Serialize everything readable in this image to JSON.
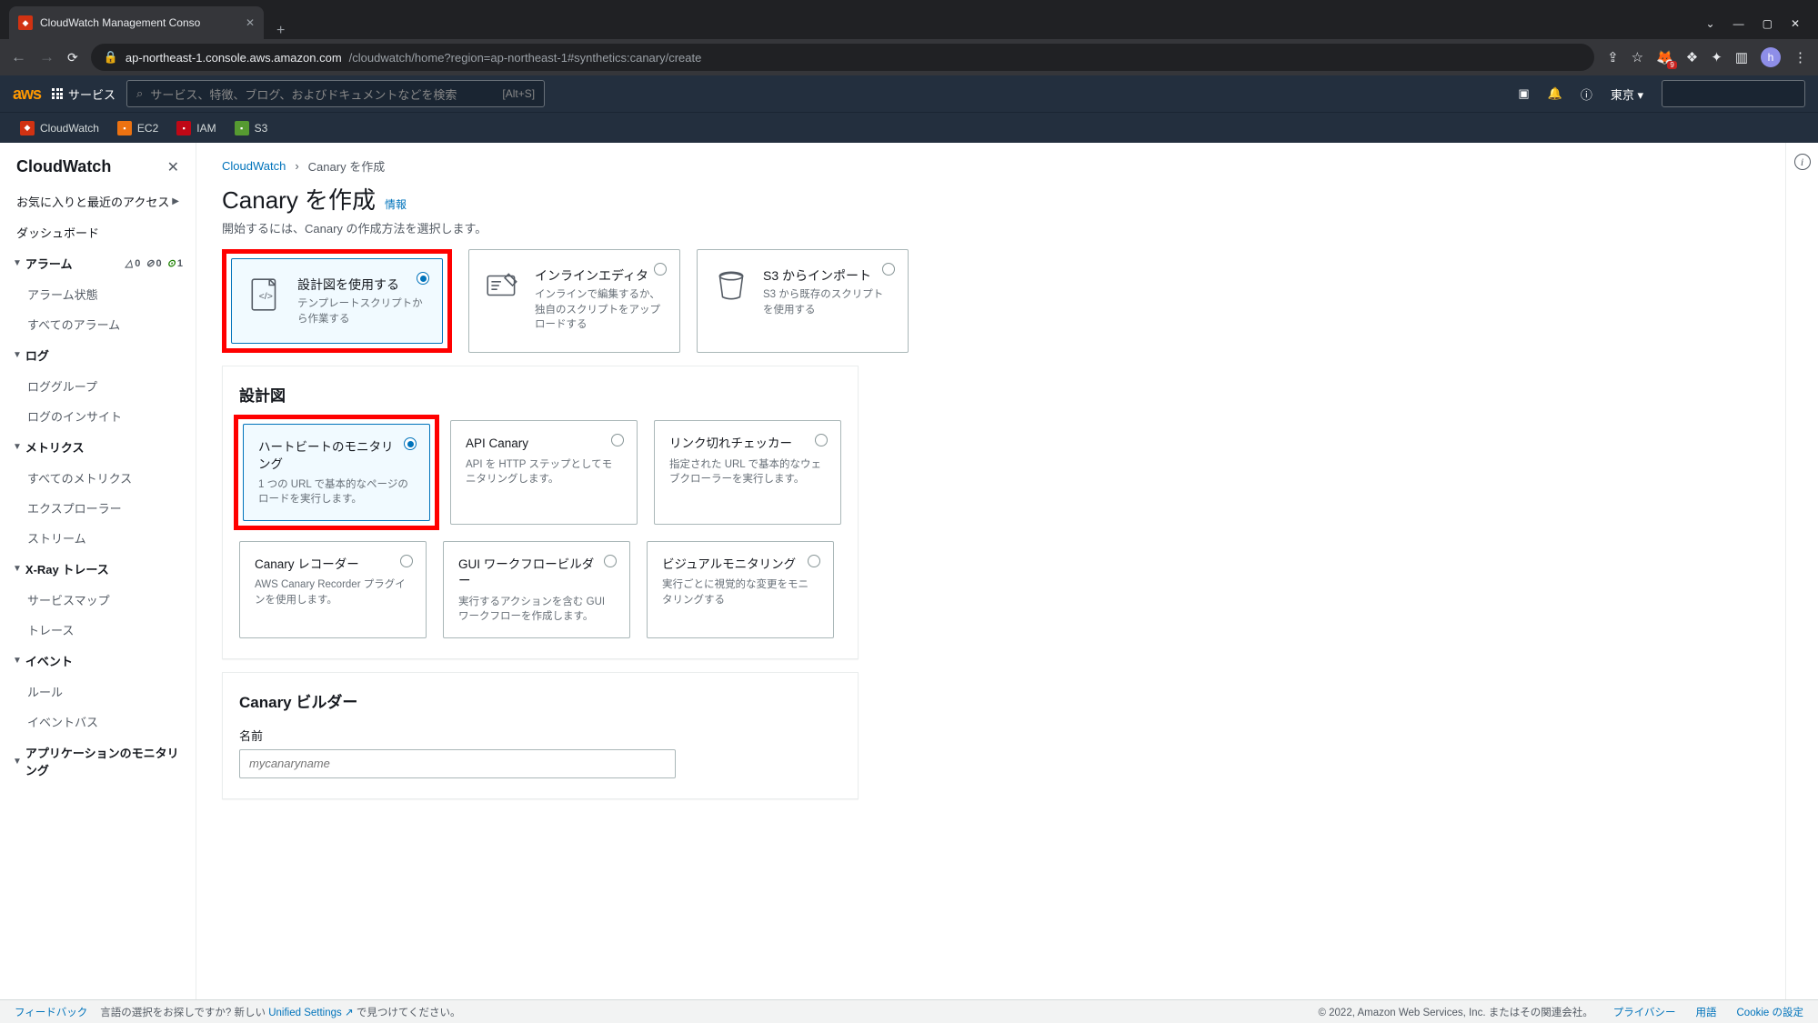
{
  "browser": {
    "tab_title": "CloudWatch Management Conso",
    "url_host": "ap-northeast-1.console.aws.amazon.com",
    "url_path": "/cloudwatch/home?region=ap-northeast-1#synthetics:canary/create"
  },
  "aws_nav": {
    "services_label": "サービス",
    "search_placeholder": "サービス、特徴、ブログ、およびドキュメントなどを検索",
    "search_hint": "[Alt+S]",
    "region": "東京",
    "favorites": [
      {
        "name": "CloudWatch"
      },
      {
        "name": "EC2"
      },
      {
        "name": "IAM"
      },
      {
        "name": "S3"
      }
    ]
  },
  "sidebar": {
    "title": "CloudWatch",
    "recent": "お気に入りと最近のアクセス",
    "dashboard": "ダッシュボード",
    "sections": {
      "alarms": {
        "label": "アラーム",
        "badges": {
          "in_alarm": "0",
          "no_data": "0",
          "ok": "1"
        },
        "items": [
          "アラーム状態",
          "すべてのアラーム"
        ]
      },
      "logs": {
        "label": "ログ",
        "items": [
          "ロググループ",
          "ログのインサイト"
        ]
      },
      "metrics": {
        "label": "メトリクス",
        "items": [
          "すべてのメトリクス",
          "エクスプローラー",
          "ストリーム"
        ]
      },
      "xray": {
        "label": "X-Ray トレース",
        "items": [
          "サービスマップ",
          "トレース"
        ]
      },
      "events": {
        "label": "イベント",
        "items": [
          "ルール",
          "イベントバス"
        ]
      },
      "appmon": {
        "label": "アプリケーションのモニタリング"
      }
    }
  },
  "breadcrumb": {
    "root": "CloudWatch",
    "current": "Canary を作成"
  },
  "page": {
    "title": "Canary を作成",
    "info_link": "情報",
    "desc": "開始するには、Canary の作成方法を選択します。"
  },
  "method_cards": [
    {
      "title": "設計図を使用する",
      "desc": "テンプレートスクリプトから作業する",
      "selected": true
    },
    {
      "title": "インラインエディタ",
      "desc": "インラインで編集するか、独自のスクリプトをアップロードする",
      "selected": false
    },
    {
      "title": "S3 からインポート",
      "desc": "S3 から既存のスクリプトを使用する",
      "selected": false
    }
  ],
  "blueprint_panel": {
    "title": "設計図",
    "cards": [
      {
        "title": "ハートビートのモニタリング",
        "desc": "1 つの URL で基本的なページのロードを実行します。",
        "selected": true
      },
      {
        "title": "API Canary",
        "desc": "API を HTTP ステップとしてモニタリングします。",
        "selected": false
      },
      {
        "title": "リンク切れチェッカー",
        "desc": "指定された URL で基本的なウェブクローラーを実行します。",
        "selected": false
      },
      {
        "title": "Canary レコーダー",
        "desc": "AWS Canary Recorder プラグインを使用します。",
        "selected": false
      },
      {
        "title": "GUI ワークフロービルダー",
        "desc": "実行するアクションを含む GUI ワークフローを作成します。",
        "selected": false
      },
      {
        "title": "ビジュアルモニタリング",
        "desc": "実行ごとに視覚的な変更をモニタリングする",
        "selected": false
      }
    ]
  },
  "builder_panel": {
    "title": "Canary ビルダー",
    "name_label": "名前",
    "name_placeholder": "mycanaryname"
  },
  "footer": {
    "feedback": "フィードバック",
    "lang_prompt": "言語の選択をお探しですか? 新しい",
    "unified": "Unified Settings",
    "lang_suffix": "で見つけてください。",
    "copyright": "© 2022, Amazon Web Services, Inc. またはその関連会社。",
    "privacy": "プライバシー",
    "terms": "用語",
    "cookie": "Cookie の設定"
  }
}
